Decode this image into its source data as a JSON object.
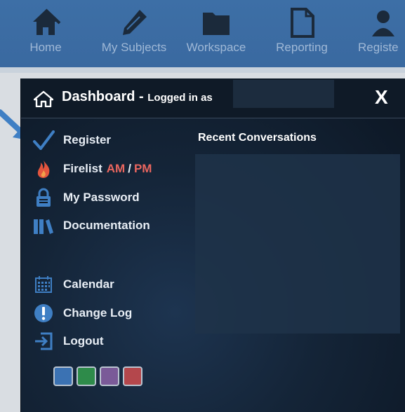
{
  "nav": {
    "items": [
      {
        "label": "Home",
        "icon": "home-icon"
      },
      {
        "label": "My Subjects",
        "icon": "pencil-icon"
      },
      {
        "label": "Workspace",
        "icon": "folder-icon"
      },
      {
        "label": "Reporting",
        "icon": "document-icon"
      },
      {
        "label": "Registe",
        "icon": "users-icon"
      }
    ]
  },
  "dashboard": {
    "title": "Dashboard",
    "separator": "-",
    "logged_in_label": "Logged in as",
    "close_label": "X"
  },
  "menu": {
    "register": "Register",
    "firelist": "Firelist",
    "firelist_am": "AM",
    "firelist_slash": "/",
    "firelist_pm": "PM",
    "my_password": "My Password",
    "documentation": "Documentation",
    "calendar": "Calendar",
    "change_log": "Change Log",
    "logout": "Logout"
  },
  "recent": {
    "title": "Recent Conversations"
  },
  "theme_swatches": {
    "colors": [
      "#3b72b3",
      "#2e8b4a",
      "#7a5a98",
      "#b4474c"
    ]
  },
  "colors": {
    "nav_bg": "#3d6fa6",
    "panel_bg": "#142437",
    "accent_red": "#e9665f"
  }
}
